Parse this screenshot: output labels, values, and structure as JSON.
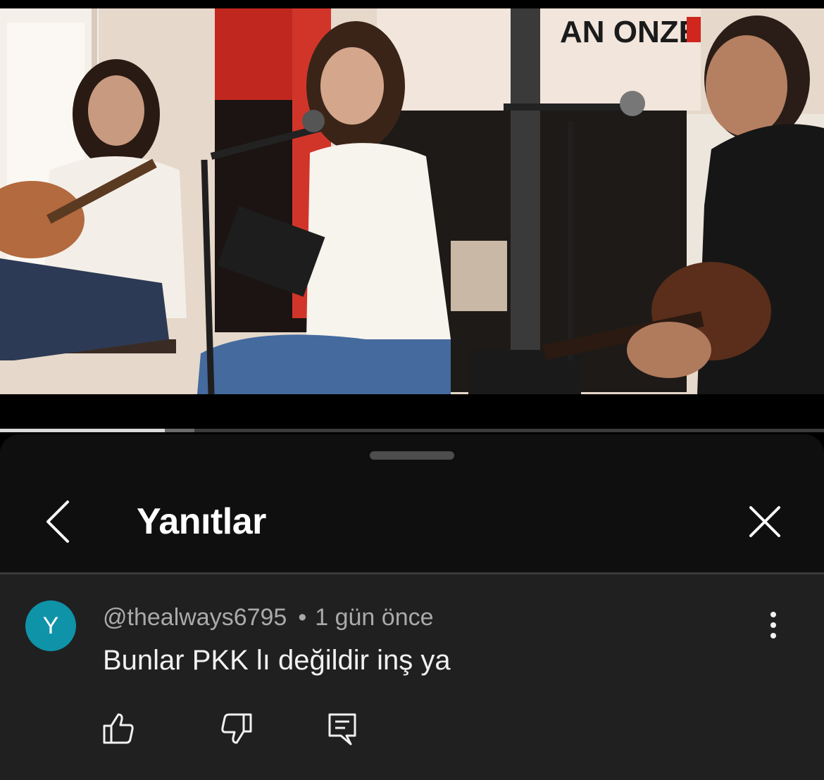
{
  "video": {
    "banner_text": "AN ONZE",
    "progress": {
      "played_fraction": 0.2,
      "buffered_fraction": 0.236
    }
  },
  "sheet": {
    "title": "Yanıtlar",
    "back_icon": "chevron-left-icon",
    "close_icon": "close-icon"
  },
  "comment": {
    "avatar_letter": "Y",
    "avatar_color": "#0f93a8",
    "author": "@thealways6795",
    "separator": "•",
    "time": "1 gün önce",
    "text": "Bunlar PKK lı değildir inş ya",
    "actions": {
      "like_icon": "thumbs-up-icon",
      "dislike_icon": "thumbs-down-icon",
      "reply_icon": "reply-comment-icon",
      "more_icon": "more-vertical-icon"
    }
  }
}
